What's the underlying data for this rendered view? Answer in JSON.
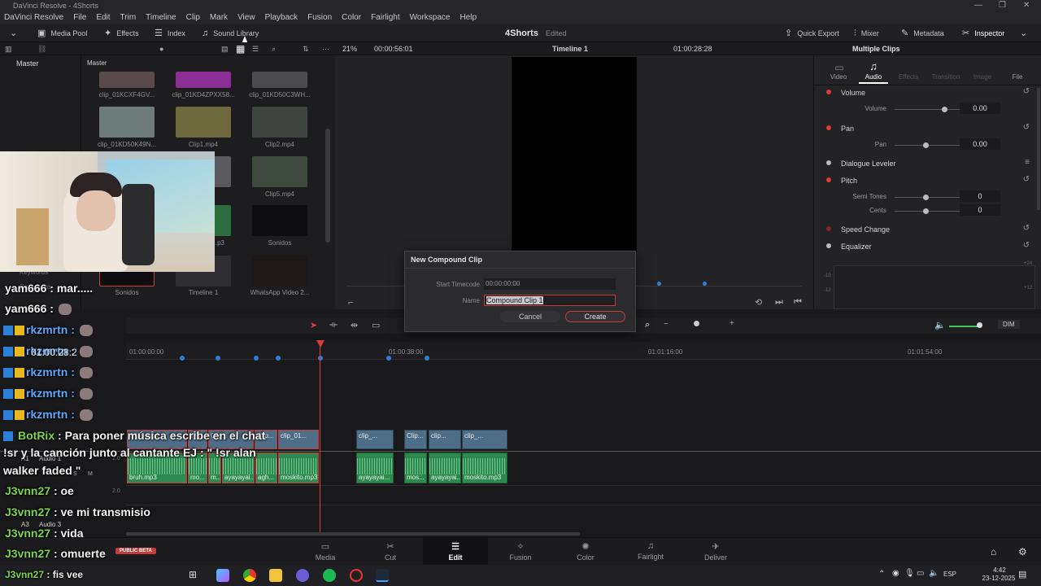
{
  "window": {
    "title": "DaVinci Resolve - 4Shorts"
  },
  "menu": [
    "DaVinci Resolve",
    "File",
    "Edit",
    "Trim",
    "Timeline",
    "Clip",
    "Mark",
    "View",
    "Playback",
    "Fusion",
    "Color",
    "Fairlight",
    "Workspace",
    "Help"
  ],
  "toolbar": {
    "media_pool": "Media Pool",
    "effects": "Effects",
    "index": "Index",
    "sound_library": "Sound Library",
    "project_name": "4Shorts",
    "project_status": "Edited",
    "quick_export": "Quick Export",
    "mixer": "Mixer",
    "metadata": "Metadata",
    "inspector": "Inspector"
  },
  "subbar": {
    "zoom": "21%",
    "source_timecode": "00:00:56:01",
    "timeline_name": "Timeline 1",
    "record_timecode": "01:00:28:28",
    "inspector_title": "Multiple Clips"
  },
  "left_pane": {
    "bin": "Master",
    "hidden_labels": [
      "Keywords",
      "Collections"
    ]
  },
  "media_pool": {
    "path": "Master",
    "clips": [
      {
        "name": "clip_01KCXF4GV..."
      },
      {
        "name": "clip_01KD4ZPXX58..."
      },
      {
        "name": "clip_01KD50C3WH..."
      },
      {
        "name": "clip_01KD50K49N..."
      },
      {
        "name": "Clip1.mp4"
      },
      {
        "name": "Clip2.mp4"
      },
      {
        "name": "Clip4..."
      },
      {
        "name": "Clip5.mp4"
      },
      {
        "name": "...p3"
      },
      {
        "name": "Sonidos"
      },
      {
        "name": "Sonidos"
      },
      {
        "name": "Timeline 1"
      },
      {
        "name": "WhatsApp Video 2..."
      }
    ]
  },
  "inspector": {
    "tabs": [
      "Video",
      "Audio",
      "Effects",
      "Transition",
      "Image",
      "File"
    ],
    "active_tab": "Audio",
    "sections": {
      "volume": "Volume",
      "volume_param": "Volume",
      "volume_value": "0.00",
      "pan": "Pan",
      "pan_param": "Pan",
      "pan_value": "0.00",
      "dialogue_leveler": "Dialogue Leveler",
      "pitch": "Pitch",
      "semi_tones": "Semi Tones",
      "semi_tones_value": "0",
      "cents": "Cents",
      "cents_value": "0",
      "speed_change": "Speed Change",
      "equalizer": "Equalizer",
      "eq_db": [
        "+24",
        "+12",
        "-10",
        "-12"
      ]
    }
  },
  "dialog": {
    "title": "New Compound Clip",
    "start_timecode_label": "Start Timecode",
    "start_timecode_value": "00:00:00:00",
    "name_label": "Name",
    "name_value": "Compound Clip 1",
    "cancel": "Cancel",
    "create": "Create"
  },
  "timeline": {
    "ruler": [
      "01:00:00:00",
      "01:00:38:00",
      "01:01:16:00",
      "01:01:54:00"
    ],
    "timecode_overlay": "01:00:28:2",
    "dim": "DIM",
    "tracks": {
      "v1": "V1",
      "a1": "A1",
      "a1_name": "Audio 1",
      "a1_level": "2.0",
      "a2_level": "2.0",
      "a3": "A3",
      "a3_name": "Audio 3",
      "a3_level": "2.0",
      "s": "S",
      "m": "M"
    },
    "video_clips": [
      "Clip6.mp4",
      "Wh...",
      "Clip...",
      "Clip...",
      "clip_01...",
      "clip_...",
      "Clip...",
      "clip...",
      "clip_..."
    ],
    "audio_clips": [
      "bruh.mp3",
      "mo...",
      "m...",
      "ayayayai...",
      "agh...",
      "moskito.mp3",
      "ayayayai...",
      "mos...",
      "ayayayai...",
      "moskito.mp3"
    ]
  },
  "page_tabs": [
    "Media",
    "Cut",
    "Edit",
    "Fusion",
    "Color",
    "Fairlight",
    "Deliver"
  ],
  "active_page": "Edit",
  "public_beta": "PUBLIC BETA",
  "chat": [
    {
      "user": "yam666",
      "msg": "",
      "color": "#f4f4f4"
    },
    {
      "user": "yam666",
      "msg": "",
      "color": "#f4f4f4"
    },
    {
      "user": "rkzmrtn",
      "msg": "",
      "color": "#5aa9ff"
    },
    {
      "user": "rkzmrtn",
      "msg": "",
      "color": "#5aa9ff"
    },
    {
      "user": "rkzmrtn",
      "msg": "",
      "color": "#5aa9ff"
    },
    {
      "user": "rkzmrtn",
      "msg": "",
      "color": "#5aa9ff"
    },
    {
      "user": "rkzmrtn",
      "msg": "",
      "color": "#5aa9ff"
    },
    {
      "user": "BotRix",
      "msg": "Para poner música escribe en el chat !sr y la canción junto al cantante EJ : \" !sr alan walker faded \"",
      "color": "#7bd44a"
    },
    {
      "user": "J3vnn27",
      "msg": "oe",
      "color": "#7bd44a"
    },
    {
      "user": "J3vnn27",
      "msg": "ve mi transmisio",
      "color": "#7bd44a"
    },
    {
      "user": "J3vnn27",
      "msg": "vida",
      "color": "#7bd44a"
    },
    {
      "user": "J3vnn27",
      "msg": "omuerte",
      "color": "#7bd44a"
    },
    {
      "user": "J3vnn27",
      "msg": "fis vee",
      "color": "#7bd44a"
    }
  ],
  "chat_lines": {
    "l0": "yam666 : mar.....",
    "l1": "yam666 :",
    "l2": "rkzmrtn :",
    "l3": "rkzmrtn :",
    "l4": "rkzmrtn :",
    "l5": "rkzmrtn :",
    "l6": "rkzmrtn :",
    "l7a": "BotRix",
    "l7b": ": Para poner música escribe en el chat",
    "l7c": "!sr y la canción junto al cantante EJ : \" !sr alan",
    "l7d": "walker faded \"",
    "l8": "J3vnn27",
    "l8m": ": oe",
    "l9": "J3vnn27",
    "l9m": ": ve mi transmisio",
    "l10": "J3vnn27",
    "l10m": ": vida",
    "l11": "J3vnn27",
    "l11m": ": omuerte",
    "l12": "J3vnn27",
    "l12m": ": fis vee"
  },
  "taskbar": {
    "lang": "ESP",
    "time": "4:42",
    "date": "23-12-2025"
  },
  "colors": {
    "accent_red": "#c43c3c",
    "video_clip": "#4e6d86",
    "audio_clip": "#2c8a4e",
    "marker": "#2f7fd8"
  }
}
